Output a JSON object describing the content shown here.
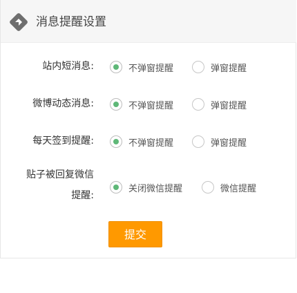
{
  "panel": {
    "title": "消息提醒设置",
    "icon": "diamond-icon"
  },
  "settings": [
    {
      "label": "站内短消息:",
      "options": [
        "不弹窗提醒",
        "弹窗提醒"
      ],
      "selected": "不弹窗提醒"
    },
    {
      "label": "微博动态消息:",
      "options": [
        "不弹窗提醒",
        "弹窗提醒"
      ],
      "selected": "不弹窗提醒"
    },
    {
      "label": "每天签到提醒:",
      "options": [
        "不弹窗提醒",
        "弹窗提醒"
      ],
      "selected": "不弹窗提醒"
    },
    {
      "label_line1": "贴子被回复微信",
      "label_line2": "提醒:",
      "options": [
        "关闭微信提醒",
        "微信提醒"
      ],
      "selected": "关闭微信提醒"
    }
  ],
  "submit_label": "提交",
  "colors": {
    "accent_green": "#5fb878",
    "button_orange": "#ff9900",
    "header_bg": "#f6f6f6",
    "icon_gray": "#6e6e6e"
  }
}
